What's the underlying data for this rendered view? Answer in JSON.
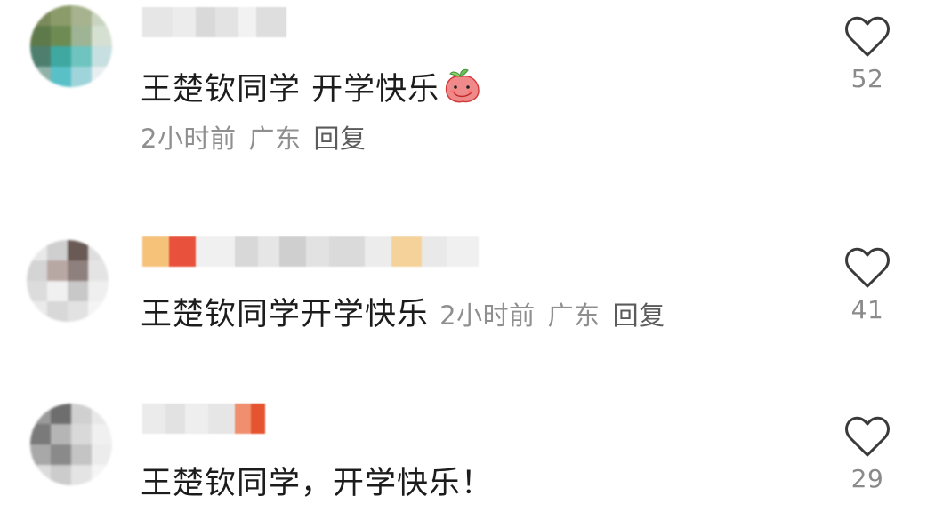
{
  "comments": [
    {
      "text": "王楚钦同学  开学快乐",
      "emoji_icon": "peach-emoji-icon",
      "time": "2小时前",
      "location": "广东",
      "reply_label": "回复",
      "likes": "52",
      "avatar_colors": [
        "#7b8a5c",
        "#8b9c6a",
        "#a7b28f",
        "#c9d4c0",
        "#5f7a4a",
        "#6d8b52",
        "#9fb494",
        "#d6e0d2",
        "#4e7f6e",
        "#3fa8a0",
        "#6fc4c0",
        "#c7dfe0",
        "#8fb2a8",
        "#5ac0c8",
        "#9fd4da",
        "#e8eef0"
      ],
      "username_colors": [
        "#e6e6e6",
        "#ececec",
        "#d9d9d9",
        "#e3e3e3",
        "#f2f2f2",
        "#dedede"
      ]
    },
    {
      "text": "王楚钦同学开学快乐",
      "time": "2小时前",
      "location": "广东",
      "reply_label": "回复",
      "likes": "41",
      "avatar_colors": [
        "#e8e8e8",
        "#cfcfcf",
        "#6a5a55",
        "#dedede",
        "#d4d4d4",
        "#b8a8a4",
        "#8e807c",
        "#e4e4e4",
        "#dcdcdc",
        "#f0f0f0",
        "#c8c8c8",
        "#efefef",
        "#eaeaea",
        "#d8d8d8",
        "#e2e2e2",
        "#f4f4f4"
      ],
      "username_colors": [
        "#f6c27a",
        "#e8523c",
        "#f0f0f0",
        "#d8d8d8",
        "#e6e6e6",
        "#cfcfcf",
        "#e2e2e2",
        "#dadada",
        "#ececec",
        "#f4d29a",
        "#e9e9e9",
        "#f0f0f0"
      ]
    },
    {
      "text": "王楚钦同学，开学快乐！",
      "likes": "29",
      "avatar_colors": [
        "#9a9a9a",
        "#6e6e6e",
        "#d0d0d0",
        "#e8e8e8",
        "#7a7a7a",
        "#b5b5b5",
        "#d9d9d9",
        "#f0f0f0",
        "#a8a8a8",
        "#8a8a8a",
        "#c4c4c4",
        "#ececec",
        "#dcdcdc",
        "#cccccc",
        "#e4e4e4",
        "#f5f5f5"
      ],
      "username_colors": [
        "#ebebeb",
        "#e2e2e2",
        "#eeeeee",
        "#e6e6e6",
        "#ef8f6e",
        "#e5542f"
      ]
    }
  ]
}
